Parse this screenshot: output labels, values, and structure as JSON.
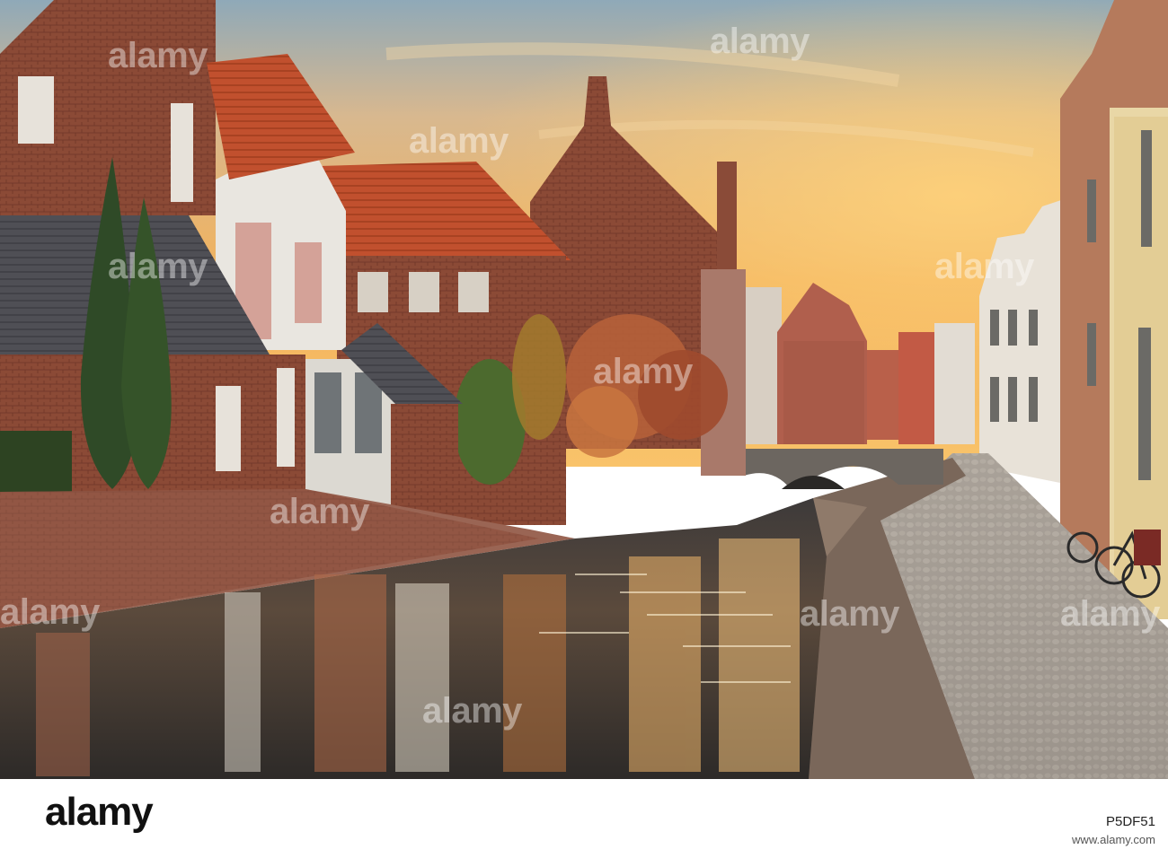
{
  "watermark": {
    "text": "alamy"
  },
  "footer": {
    "logo_text": "alamy",
    "image_id": "P5DF51",
    "meta_line": "www.alamy.com"
  }
}
